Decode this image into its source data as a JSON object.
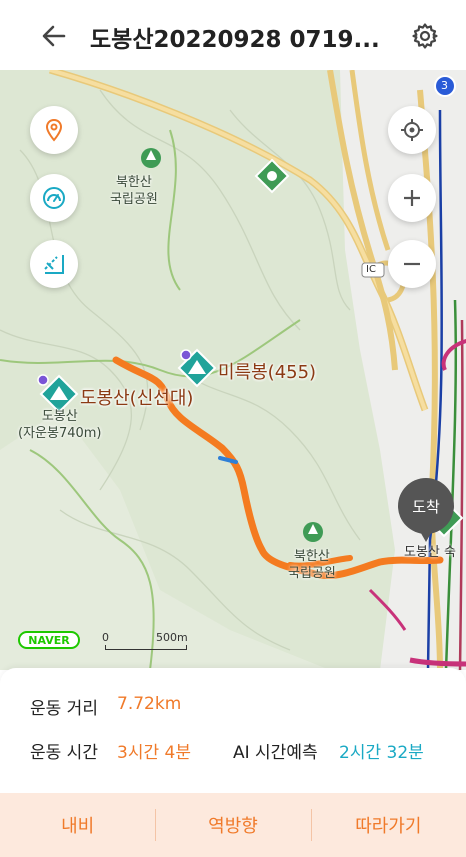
{
  "header": {
    "title": "도봉산20220928 0719...",
    "back_icon": "back-arrow-icon",
    "settings_icon": "gear-icon"
  },
  "map": {
    "controls_left": [
      "location-pin-icon",
      "speedometer-icon",
      "slope-icon"
    ],
    "controls_right": [
      "gps-target-icon",
      "zoom-in-icon",
      "zoom-out-icon"
    ],
    "labels": {
      "park_top": "북한산\n국립공원",
      "park_bottom": "북한산\n국립공원",
      "peak_mireuk": "미륵봉(455)",
      "peak_dobong": "도봉산(신선대)",
      "dobong_main": "도봉산\n(자운봉740m)",
      "station_partial": "도봉산 숙",
      "ic": "IC",
      "route_num": "3"
    },
    "arrival_label": "도착",
    "naver_logo": "NAVER",
    "scale": {
      "start": "0",
      "end": "500m"
    },
    "route_color": "#f47b20"
  },
  "stats": {
    "distance_label": "운동 거리",
    "distance_value": "7.72km",
    "time_label": "운동 시간",
    "time_value": "3시간 4분",
    "ai_label": "AI 시간예측",
    "ai_value": "2시간 32분",
    "orange": "#f07a2a",
    "teal": "#1aa9c4"
  },
  "bottom_bar": {
    "buttons": [
      "내비",
      "역방향",
      "따라가기"
    ]
  }
}
